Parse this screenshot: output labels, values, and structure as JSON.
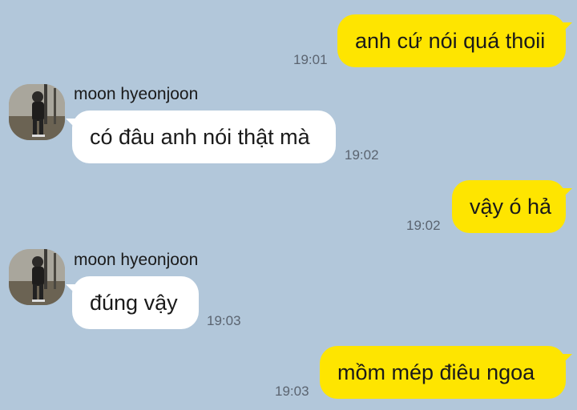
{
  "messages": [
    {
      "from": "me",
      "text": "anh cứ nói quá thoii",
      "time": "19:01"
    },
    {
      "from": "them",
      "sender": "moon hyeonjoon",
      "avatar": "profile-photo-icon",
      "text": "có đâu anh nói thật mà",
      "time": "19:02"
    },
    {
      "from": "me",
      "text": "vậy ó hả",
      "time": "19:02"
    },
    {
      "from": "them",
      "sender": "moon hyeonjoon",
      "avatar": "profile-photo-icon",
      "text": "đúng vậy",
      "time": "19:03"
    },
    {
      "from": "me",
      "text": "mồm mép điêu ngoa",
      "time": "19:03"
    }
  ],
  "colors": {
    "background": "#b2c7da",
    "my_bubble": "#fee500",
    "their_bubble": "#ffffff",
    "time_text": "#5b6470"
  }
}
